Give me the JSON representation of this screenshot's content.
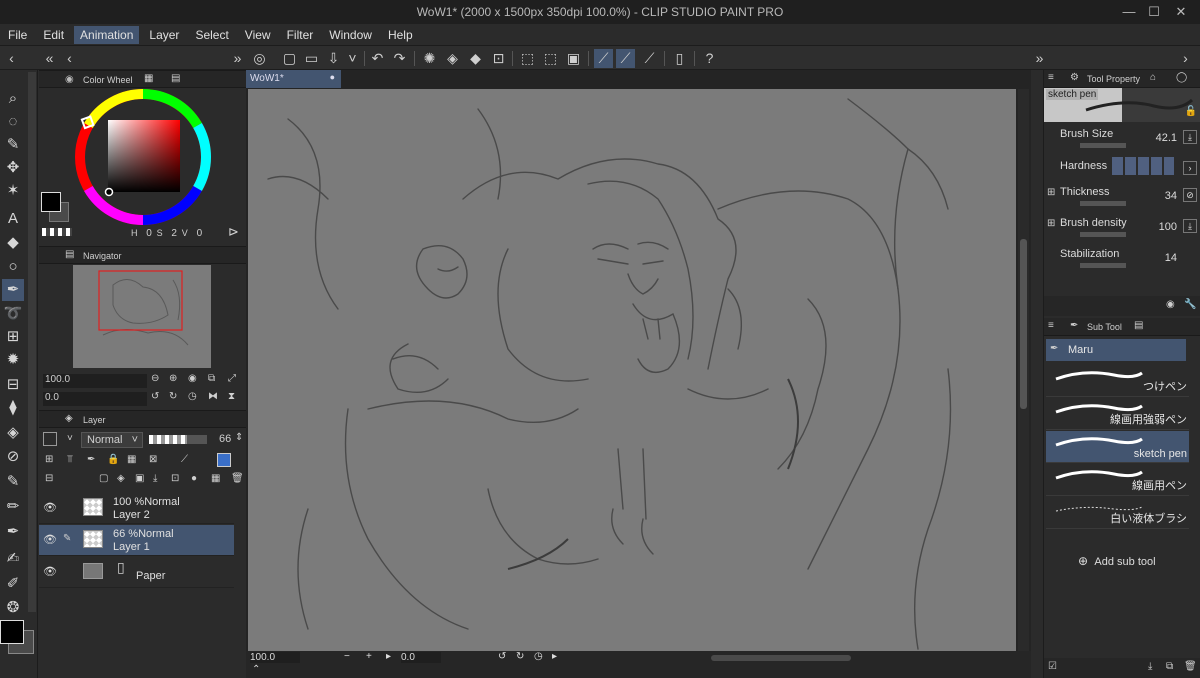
{
  "window": {
    "title": "WoW1* (2000 x 1500px 350dpi 100.0%) - CLIP STUDIO PAINT PRO"
  },
  "menu": [
    "File",
    "Edit",
    "Animation",
    "Layer",
    "Select",
    "View",
    "Filter",
    "Window",
    "Help"
  ],
  "menu_active": "Animation",
  "color_wheel": {
    "tab_label": "Color Wheel",
    "h_label": "H",
    "h_value": "0",
    "s_label": "S",
    "s_value": "2",
    "v_label": "V",
    "v_value": "0",
    "main_color": "#000000",
    "sub_color": "#4a4a4a"
  },
  "navigator": {
    "tab_label": "Navigator",
    "zoom_value": "100.0",
    "rotate_value": "0.0"
  },
  "layer_panel": {
    "tab_label": "Layer",
    "blend_mode": "Normal",
    "opacity": "66",
    "layers": [
      {
        "info": "100 %Normal",
        "name": "Layer 2"
      },
      {
        "info": "66 %Normal",
        "name": "Layer 1"
      },
      {
        "info": "",
        "name": "Paper"
      }
    ]
  },
  "canvas": {
    "doc_tab": "WoW1*",
    "status_zoom": "100.0",
    "status_angle": "0.0"
  },
  "tool_property": {
    "tab_label": "Tool Property",
    "preset_name": "sketch pen",
    "brush_size_label": "Brush Size",
    "brush_size_value": "42.1",
    "hardness_label": "Hardness",
    "thickness_label": "Thickness",
    "thickness_value": "34",
    "brush_density_label": "Brush density",
    "brush_density_value": "100",
    "stabilization_label": "Stabilization",
    "stabilization_value": "14"
  },
  "sub_tool": {
    "tab_label": "Sub Tool",
    "group_name": "Maru",
    "items": [
      "つけペン",
      "線画用強弱ペン",
      "sketch pen",
      "線画用ペン",
      "白い液体ブラシ"
    ],
    "selected_index": 2,
    "add_label": "Add sub tool"
  }
}
